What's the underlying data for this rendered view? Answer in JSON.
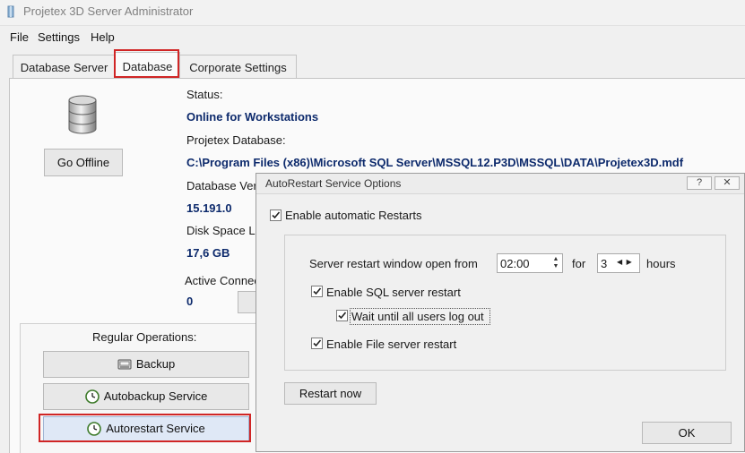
{
  "window": {
    "title": "Projetex 3D Server Administrator"
  },
  "menu": {
    "items": [
      "File",
      "Settings",
      "Help"
    ]
  },
  "tabs": [
    {
      "label": "Database Server",
      "active": false
    },
    {
      "label": "Database",
      "active": true
    },
    {
      "label": "Corporate Settings",
      "active": false
    }
  ],
  "database": {
    "status_label": "Status:",
    "status_value": "Online for Workstations",
    "db_label": "Projetex Database:",
    "db_path": "C:\\Program Files (x86)\\Microsoft SQL Server\\MSSQL12.P3D\\MSSQL\\DATA\\Projetex3D.mdf",
    "version_label": "Database Ver",
    "version_value": "15.191.0",
    "disk_label": "Disk Space Le",
    "disk_value": "17,6 GB",
    "conn_label": "Active Connec",
    "conn_value": "0",
    "go_offline": "Go Offline"
  },
  "operations": {
    "title": "Regular Operations:",
    "backup": "Backup",
    "autobackup": "Autobackup Service",
    "autorestart": "Autorestart Service"
  },
  "dialog": {
    "title": "AutoRestart Service Options",
    "help_btn": "?",
    "close_btn": "✕",
    "enable_restarts": "Enable automatic Restarts",
    "window_label": "Server restart window open from",
    "time_value": "02:00",
    "for_label": "for",
    "hours_value": "3",
    "hours_label": "hours",
    "sql_restart": "Enable SQL server restart",
    "wait_users": "Wait until all users log out",
    "file_restart": "Enable File server restart",
    "restart_now": "Restart now",
    "ok": "OK"
  },
  "colors": {
    "highlight_red": "#d02525",
    "value_blue": "#0d2a6c",
    "selected_btn": "#dfe8f6"
  }
}
